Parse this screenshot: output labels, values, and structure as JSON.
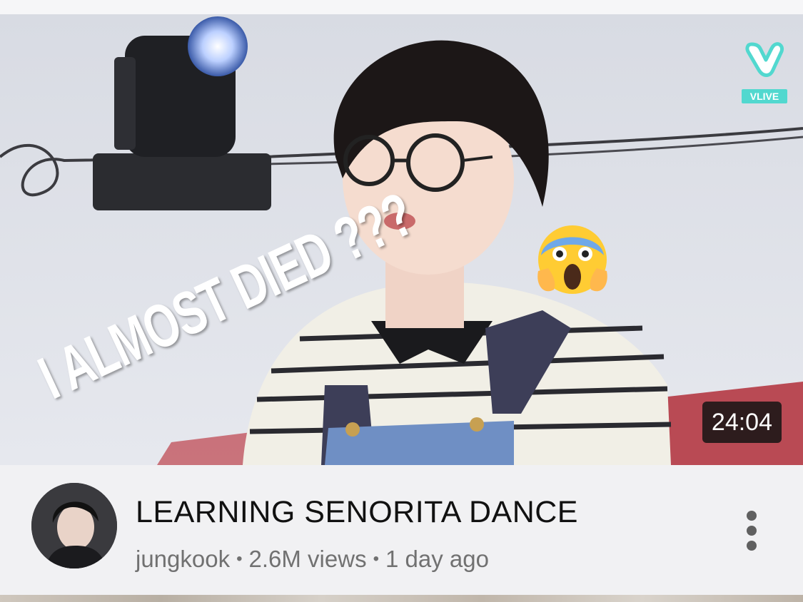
{
  "video": {
    "overlay_text": "I ALMOST DIED ???",
    "duration": "24:04",
    "badge_label": "VLIVE",
    "title": "LEARNING SENORITA DANCE",
    "channel": "jungkook",
    "separator": "•",
    "views": "2.6M views",
    "age": "1 day ago"
  },
  "icons": {
    "emoji": "face-screaming-in-fear-icon",
    "menu": "more-vertical-icon",
    "badge": "vlive-logo-icon"
  },
  "colors": {
    "vlive_accent": "#52d8cf",
    "duration_bg": "#141414",
    "title_text": "#111111",
    "meta_text": "#717171"
  }
}
